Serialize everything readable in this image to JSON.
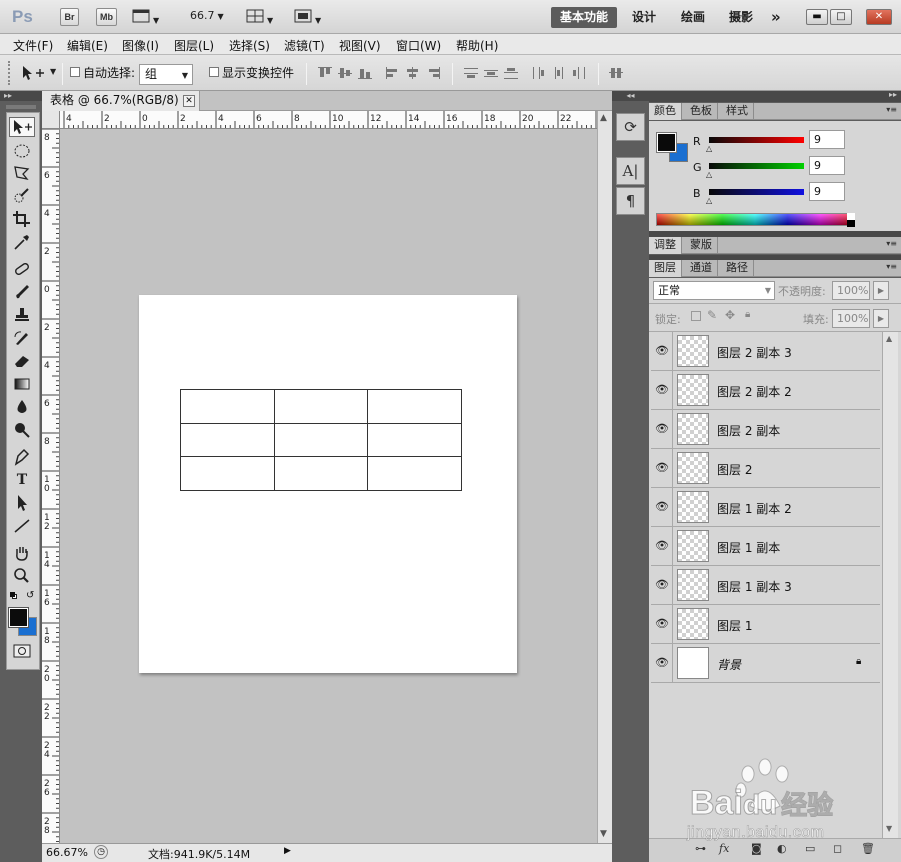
{
  "appbar": {
    "logo": "Ps",
    "br_label": "Br",
    "mb_label": "Mb",
    "zoom": "66.7",
    "workspaces": [
      "基本功能",
      "设计",
      "绘画",
      "摄影"
    ],
    "more": "»"
  },
  "menu": [
    "文件(F)",
    "编辑(E)",
    "图像(I)",
    "图层(L)",
    "选择(S)",
    "滤镜(T)",
    "视图(V)",
    "窗口(W)",
    "帮助(H)"
  ],
  "options": {
    "auto_select_label": "自动选择:",
    "auto_select_value": "组",
    "show_transform_label": "显示变换控件"
  },
  "document": {
    "tab_title": "表格 @ 66.7%(RGB/8) *",
    "close": "✕",
    "hruler_labels": [
      "4",
      "2",
      "0",
      "2",
      "4",
      "6",
      "8",
      "10",
      "12",
      "14",
      "16",
      "18",
      "20",
      "22",
      "2"
    ],
    "vruler_labels": [
      "8",
      "6",
      "4",
      "2",
      "0",
      "2",
      "4",
      "6",
      "8",
      "1 0",
      "1 2",
      "1 4",
      "1 6",
      "1 8",
      "2 0",
      "2 2",
      "2 4",
      "2 6",
      "2 8"
    ],
    "zoom": "66.67%",
    "doc_info": "文档:941.9K/5.14M"
  },
  "color_panel": {
    "tabs": [
      "颜色",
      "色板",
      "样式"
    ],
    "r_label": "R",
    "g_label": "G",
    "b_label": "B",
    "r": "9",
    "g": "9",
    "b": "9",
    "fg_color": "#090909",
    "bg_color": "#1a6fd1"
  },
  "adjust_panel": {
    "tabs": [
      "调整",
      "蒙版"
    ]
  },
  "layers_panel": {
    "tabs": [
      "图层",
      "通道",
      "路径"
    ],
    "blend_mode": "正常",
    "opacity_label": "不透明度:",
    "opacity": "100%",
    "lock_label": "锁定:",
    "fill_label": "填充:",
    "fill": "100%",
    "layers": [
      {
        "name": "图层 2 副本 3",
        "visible": true
      },
      {
        "name": "图层 2 副本 2",
        "visible": true
      },
      {
        "name": "图层 2 副本",
        "visible": true
      },
      {
        "name": "图层 2",
        "visible": true
      },
      {
        "name": "图层 1 副本 2",
        "visible": true
      },
      {
        "name": "图层 1 副本",
        "visible": true
      },
      {
        "name": "图层 1 副本 3",
        "visible": true
      },
      {
        "name": "图层 1",
        "visible": true
      }
    ],
    "background_name": "背景",
    "footer_icons": [
      "link-icon",
      "fx-icon",
      "mask-icon",
      "adjustment-icon",
      "folder-icon",
      "new-layer-icon",
      "trash-icon"
    ]
  },
  "watermark": {
    "brand": "Bai",
    "brand2": "du",
    "cn": "经验",
    "url": "jingyan.baidu.com"
  }
}
